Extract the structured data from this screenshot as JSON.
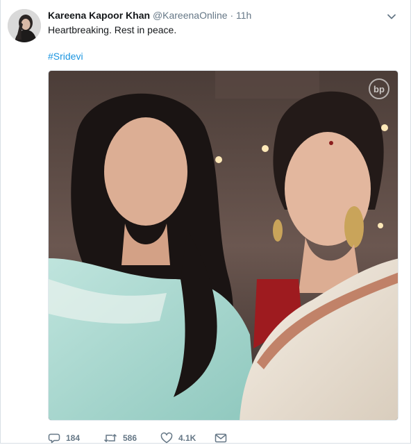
{
  "tweet": {
    "author_name": "Kareena Kapoor Khan",
    "author_handle": "@KareenaOnline",
    "separator": "·",
    "time": "11h",
    "text_line1": "Heartbreaking. Rest in peace.",
    "hashtag": "#Sridevi",
    "media_watermark": "bp"
  },
  "actions": {
    "replies": "184",
    "retweets": "586",
    "likes": "4.1K"
  },
  "colors": {
    "link": "#1b95e0",
    "muted": "#657786",
    "text": "#14171a"
  },
  "icons": [
    "caret-down-icon",
    "reply-icon",
    "retweet-icon",
    "like-icon",
    "direct-message-icon"
  ]
}
